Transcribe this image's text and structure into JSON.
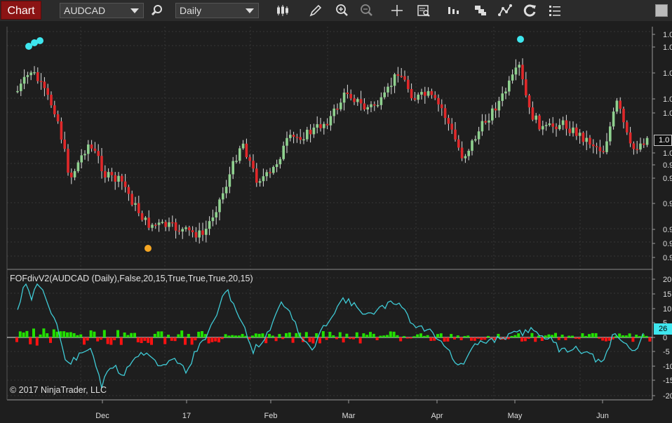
{
  "toolbar": {
    "chart_tab": "Chart",
    "instrument": "AUDCAD",
    "interval": "Daily"
  },
  "indicator": {
    "label": "FOFdivV2(AUDCAD (Daily),False,20,15,True,True,True,20,15)"
  },
  "copyright": "© 2017 NinjaTrader, LLC",
  "price_axis": {
    "labels": [
      "1.0",
      "1.0",
      "1.0",
      "1.0",
      "1.0",
      "1.0",
      "0.9",
      "0.9",
      "0.9",
      "0.9",
      "0.9",
      "0.9"
    ],
    "current_tag": "1.0"
  },
  "osc_axis": {
    "labels": [
      "20",
      "15",
      "10",
      "5",
      "0",
      "-5",
      "-10",
      "-15",
      "-20"
    ],
    "current_tag": "26"
  },
  "time_axis": {
    "labels": [
      "Dec",
      "17",
      "Feb",
      "Mar",
      "Apr",
      "May",
      "Jun"
    ]
  },
  "colors": {
    "up_candle": "#8fd18f",
    "down_candle": "#e0282a",
    "histogram_up": "#22e000",
    "histogram_down": "#ff1111",
    "oscillator_line": "#3fcbd6",
    "marker_cyan": "#3ee6ee",
    "marker_orange": "#f5a623",
    "chart_tab": "#8b1414"
  },
  "icons": [
    "search-icon",
    "bar-style-icon",
    "pencil-icon",
    "zoom-in-icon",
    "zoom-out-icon",
    "crosshair-icon",
    "data-box-icon",
    "bars-icon",
    "stack-icon",
    "strategy-icon",
    "reload-icon",
    "list-icon"
  ]
}
